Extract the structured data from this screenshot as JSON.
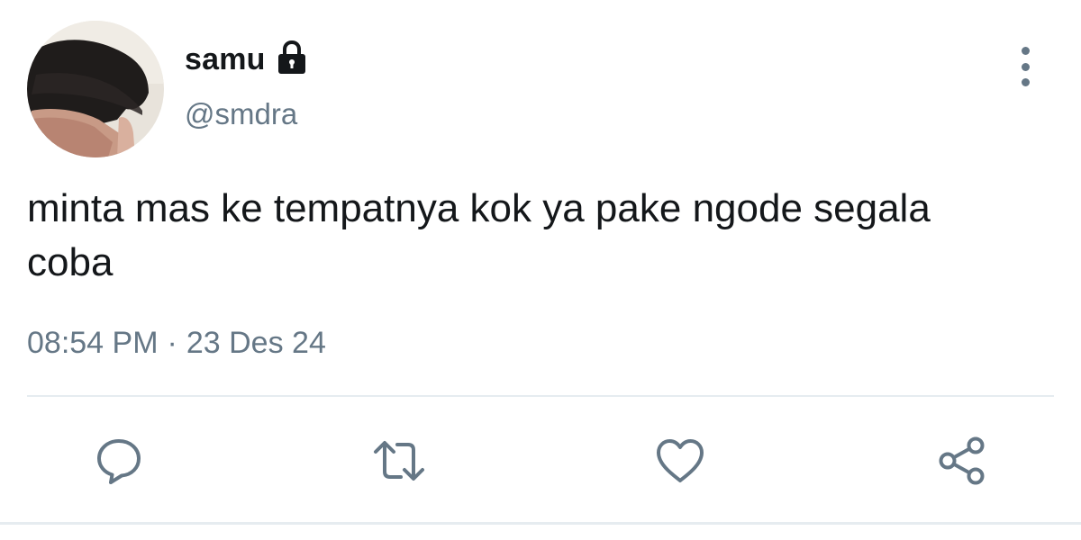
{
  "user": {
    "display_name": "samu",
    "handle": "@smdra",
    "protected_icon": "lock-icon",
    "avatar": "avatar-photo"
  },
  "tweet": {
    "text": "minta mas ke tempatnya kok ya pake ngode segala coba",
    "time": "08:54 PM",
    "separator": "·",
    "date": "23 Des 24"
  },
  "menu": {
    "icon": "more-vertical-icon"
  },
  "actions": [
    {
      "name": "reply",
      "icon": "reply-icon"
    },
    {
      "name": "retweet",
      "icon": "retweet-icon"
    },
    {
      "name": "like",
      "icon": "heart-icon"
    },
    {
      "name": "share",
      "icon": "share-icon"
    }
  ],
  "colors": {
    "text_primary": "#14171a",
    "text_secondary": "#657786",
    "icon": "#657786",
    "divider": "#e6ecf0"
  }
}
